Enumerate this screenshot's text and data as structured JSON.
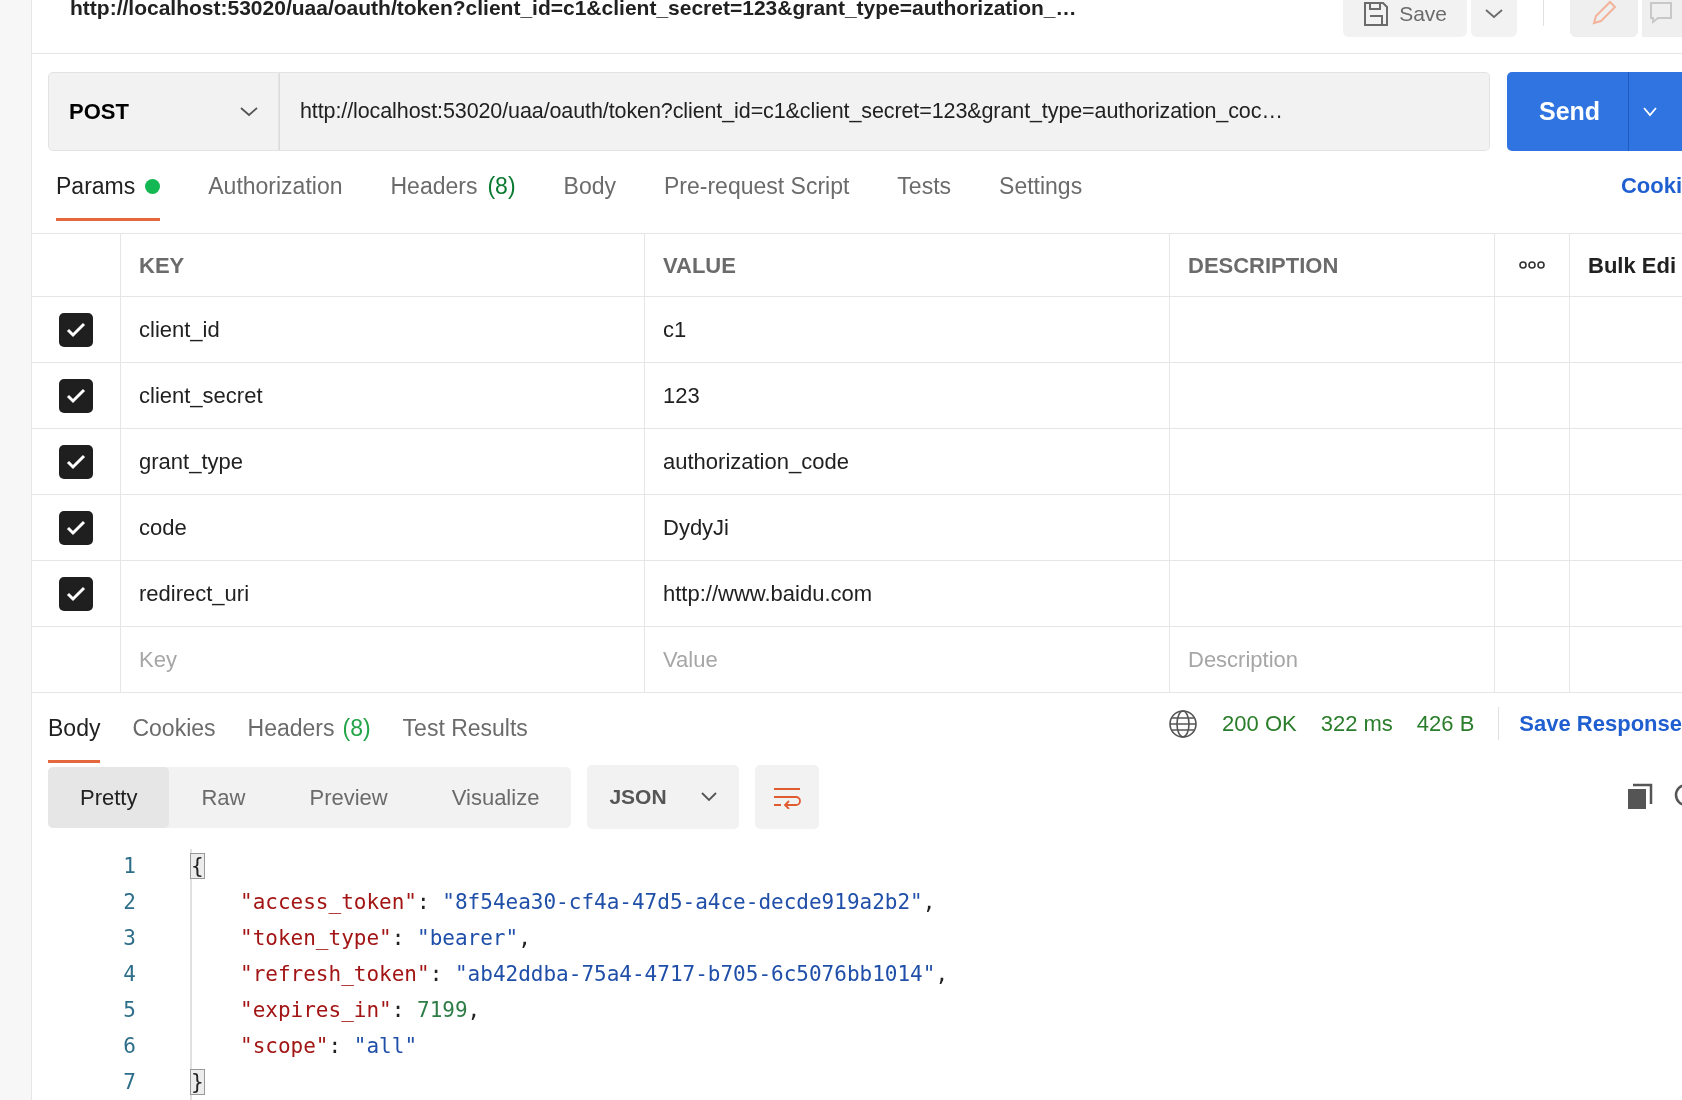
{
  "window": {
    "title": "http://localhost:53020/uaa/oauth/token?client_id=c1&client_secret=123&grant_type=authorization_…"
  },
  "toolbar": {
    "save_label": "Save"
  },
  "request": {
    "method": "POST",
    "url": "http://localhost:53020/uaa/oauth/token?client_id=c1&client_secret=123&grant_type=authorization_coc…",
    "send_label": "Send"
  },
  "request_tabs": [
    {
      "label": "Params",
      "selected": true,
      "has_dot": true
    },
    {
      "label": "Authorization",
      "selected": false,
      "has_dot": false
    },
    {
      "label": "Headers",
      "count": "(8)",
      "selected": false,
      "has_dot": false
    },
    {
      "label": "Body",
      "selected": false,
      "has_dot": false
    },
    {
      "label": "Pre-request Script",
      "selected": false,
      "has_dot": false
    },
    {
      "label": "Tests",
      "selected": false,
      "has_dot": false
    },
    {
      "label": "Settings",
      "selected": false,
      "has_dot": false
    }
  ],
  "cookies_link": "Cooki",
  "params": {
    "columns": [
      "KEY",
      "VALUE",
      "DESCRIPTION"
    ],
    "bulk_edit": "Bulk Edi",
    "rows": [
      {
        "checked": true,
        "key": "client_id",
        "value": "c1"
      },
      {
        "checked": true,
        "key": "client_secret",
        "value": "123"
      },
      {
        "checked": true,
        "key": "grant_type",
        "value": "authorization_code"
      },
      {
        "checked": true,
        "key": "code",
        "value": "DydyJi"
      },
      {
        "checked": true,
        "key": "redirect_uri",
        "value": "http://www.baidu.com"
      }
    ],
    "placeholder": {
      "key": "Key",
      "value": "Value",
      "description": "Description"
    }
  },
  "response": {
    "tabs": [
      {
        "label": "Body",
        "selected": true
      },
      {
        "label": "Cookies",
        "selected": false
      },
      {
        "label": "Headers",
        "count": "(8)",
        "selected": false
      },
      {
        "label": "Test Results",
        "selected": false
      }
    ],
    "status": "200 OK",
    "time": "322 ms",
    "size": "426 B",
    "save_response": "Save Response",
    "views": [
      {
        "label": "Pretty",
        "selected": true
      },
      {
        "label": "Raw",
        "selected": false
      },
      {
        "label": "Preview",
        "selected": false
      },
      {
        "label": "Visualize",
        "selected": false
      }
    ],
    "format": "JSON",
    "lines": [
      {
        "number": "1",
        "tokens": [
          {
            "kind": "bracket",
            "text": "{"
          }
        ]
      },
      {
        "number": "2",
        "indented": true,
        "tokens": [
          {
            "kind": "key",
            "text": "\"access_token\""
          },
          {
            "kind": "plain",
            "text": ": "
          },
          {
            "kind": "string",
            "text": "\"8f54ea30-cf4a-47d5-a4ce-decde919a2b2\""
          },
          {
            "kind": "plain",
            "text": ","
          }
        ]
      },
      {
        "number": "3",
        "indented": true,
        "tokens": [
          {
            "kind": "key",
            "text": "\"token_type\""
          },
          {
            "kind": "plain",
            "text": ": "
          },
          {
            "kind": "string",
            "text": "\"bearer\""
          },
          {
            "kind": "plain",
            "text": ","
          }
        ]
      },
      {
        "number": "4",
        "indented": true,
        "tokens": [
          {
            "kind": "key",
            "text": "\"refresh_token\""
          },
          {
            "kind": "plain",
            "text": ": "
          },
          {
            "kind": "string",
            "text": "\"ab42ddba-75a4-4717-b705-6c5076bb1014\""
          },
          {
            "kind": "plain",
            "text": ","
          }
        ]
      },
      {
        "number": "5",
        "indented": true,
        "tokens": [
          {
            "kind": "key",
            "text": "\"expires_in\""
          },
          {
            "kind": "plain",
            "text": ": "
          },
          {
            "kind": "number",
            "text": "7199"
          },
          {
            "kind": "plain",
            "text": ","
          }
        ]
      },
      {
        "number": "6",
        "indented": true,
        "tokens": [
          {
            "kind": "key",
            "text": "\"scope\""
          },
          {
            "kind": "plain",
            "text": ": "
          },
          {
            "kind": "string",
            "text": "\"all\""
          }
        ]
      },
      {
        "number": "7",
        "tokens": [
          {
            "kind": "bracket",
            "text": "}"
          }
        ]
      }
    ]
  }
}
